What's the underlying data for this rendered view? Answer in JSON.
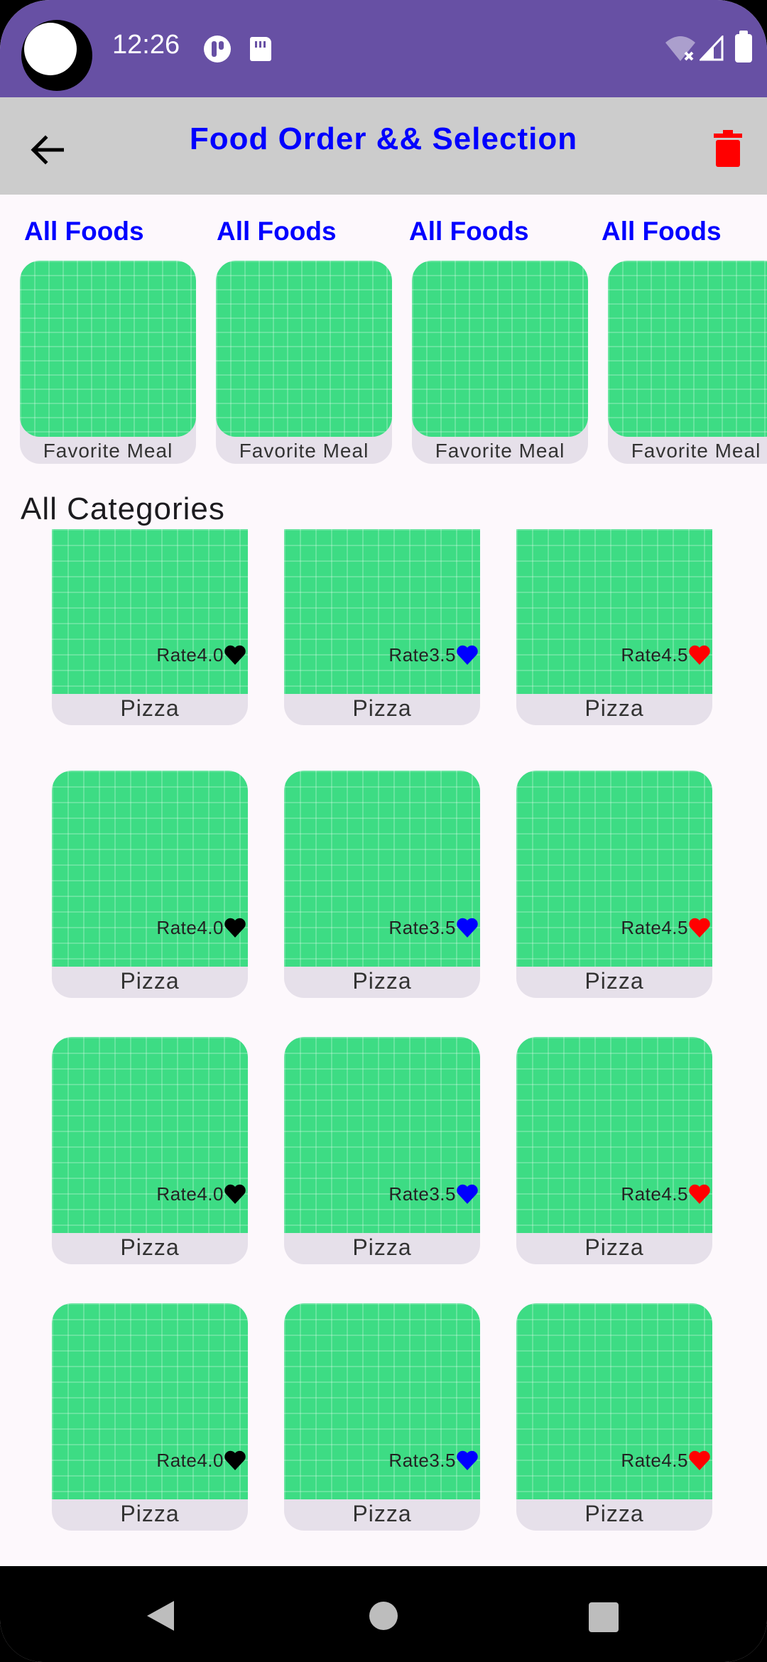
{
  "status_bar": {
    "time": "12:26"
  },
  "app_bar": {
    "title": "Food Order && Selection"
  },
  "tabs": [
    "All Foods",
    "All Foods",
    "All Foods",
    "All Foods"
  ],
  "favorites": [
    {
      "label": "Favorite Meal"
    },
    {
      "label": "Favorite Meal"
    },
    {
      "label": "Favorite Meal"
    },
    {
      "label": "Favorite Meal"
    }
  ],
  "section_title": "All Categories",
  "categories": [
    {
      "rate": "Rate4.0",
      "label": "Pizza",
      "heart_color": "#000000"
    },
    {
      "rate": "Rate3.5",
      "label": "Pizza",
      "heart_color": "#0000ff"
    },
    {
      "rate": "Rate4.5",
      "label": "Pizza",
      "heart_color": "#ff0000"
    },
    {
      "rate": "Rate4.0",
      "label": "Pizza",
      "heart_color": "#000000"
    },
    {
      "rate": "Rate3.5",
      "label": "Pizza",
      "heart_color": "#0000ff"
    },
    {
      "rate": "Rate4.5",
      "label": "Pizza",
      "heart_color": "#ff0000"
    },
    {
      "rate": "Rate4.0",
      "label": "Pizza",
      "heart_color": "#000000"
    },
    {
      "rate": "Rate3.5",
      "label": "Pizza",
      "heart_color": "#0000ff"
    },
    {
      "rate": "Rate4.5",
      "label": "Pizza",
      "heart_color": "#ff0000"
    },
    {
      "rate": "Rate4.0",
      "label": "Pizza",
      "heart_color": "#000000"
    },
    {
      "rate": "Rate3.5",
      "label": "Pizza",
      "heart_color": "#0000ff"
    },
    {
      "rate": "Rate4.5",
      "label": "Pizza",
      "heart_color": "#ff0000"
    }
  ],
  "colors": {
    "status_bar": "#6750a4",
    "app_bar": "#cccccc",
    "title_text": "#0000ff",
    "delete_icon": "#ff0000",
    "thumbnail": "#3ddc84"
  }
}
